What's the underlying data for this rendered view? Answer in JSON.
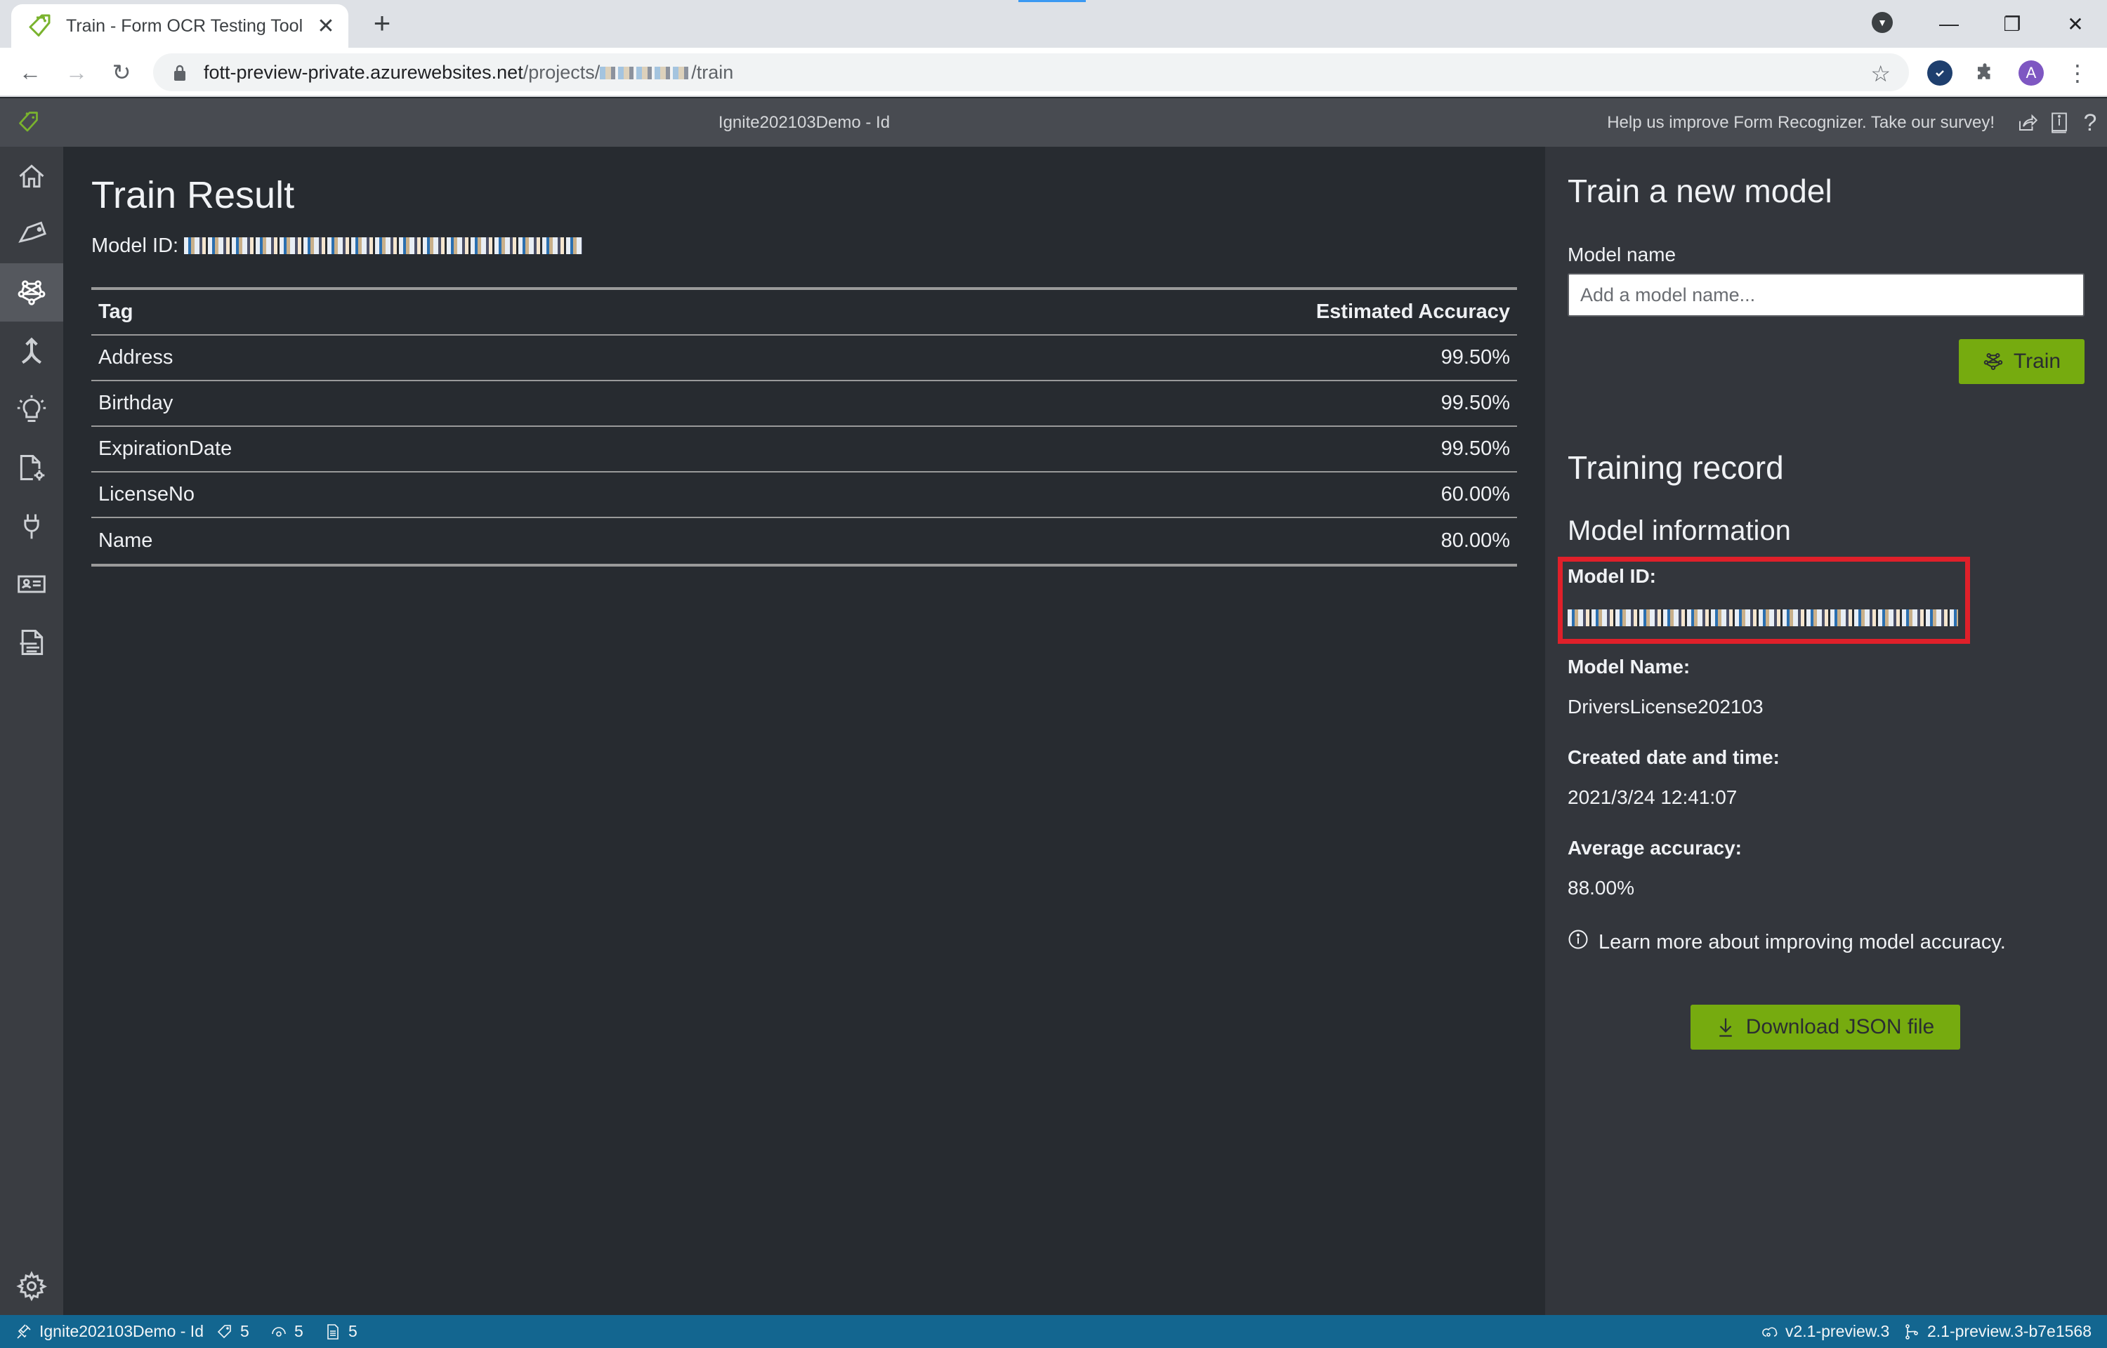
{
  "browser": {
    "tab_title": "Train - Form OCR Testing Tool",
    "close_tab_glyph": "✕",
    "new_tab_glyph": "+",
    "url_host": "fott-preview-private.azurewebsites.net",
    "url_path_prefix": "/projects/",
    "url_path_suffix": "/train",
    "profile_initial": "A",
    "window_controls": {
      "minimize": "—",
      "restore": "❐",
      "close": "✕"
    },
    "nav": {
      "back": "←",
      "forward": "→",
      "reload": "↻"
    },
    "star_glyph": "☆",
    "menu_glyph": "⋮"
  },
  "app": {
    "project_title": "Ignite202103Demo - Id",
    "survey_text": "Help us improve Form Recognizer. Take our survey!",
    "header_icons": [
      "share-icon",
      "info-book-icon",
      "help-icon"
    ],
    "accent_color": "#76ab0f"
  },
  "sidebar": {
    "items": [
      {
        "name": "home",
        "icon": "home-icon",
        "active": false
      },
      {
        "name": "tags-editor",
        "icon": "tag-icon",
        "active": false
      },
      {
        "name": "train",
        "icon": "train-network-icon",
        "active": true
      },
      {
        "name": "compose",
        "icon": "merge-icon",
        "active": false
      },
      {
        "name": "analyze",
        "icon": "lightbulb-icon",
        "active": false
      },
      {
        "name": "prebuilt",
        "icon": "document-settings-icon",
        "active": false
      },
      {
        "name": "connections",
        "icon": "plug-icon",
        "active": false
      },
      {
        "name": "layout",
        "icon": "contact-card-icon",
        "active": false
      },
      {
        "name": "read",
        "icon": "document-lines-icon",
        "active": false
      }
    ],
    "settings_icon": "gear-icon"
  },
  "main": {
    "title": "Train Result",
    "model_id_label": "Model ID:",
    "table": {
      "headers": [
        "Tag",
        "Estimated Accuracy"
      ],
      "rows": [
        {
          "tag": "Address",
          "accuracy": "99.50%"
        },
        {
          "tag": "Birthday",
          "accuracy": "99.50%"
        },
        {
          "tag": "ExpirationDate",
          "accuracy": "99.50%"
        },
        {
          "tag": "LicenseNo",
          "accuracy": "60.00%"
        },
        {
          "tag": "Name",
          "accuracy": "80.00%"
        }
      ]
    }
  },
  "right_panel": {
    "train_heading": "Train a new model",
    "model_name_label": "Model name",
    "model_name_placeholder": "Add a model name...",
    "model_name_value": "",
    "train_button": "Train",
    "record_heading": "Training record",
    "info_heading": "Model information",
    "model_id_label": "Model ID:",
    "model_name_field_label": "Model Name:",
    "model_name_field_value": "DriversLicense202103",
    "created_label": "Created date and time:",
    "created_value": "2021/3/24 12:41:07",
    "avg_accuracy_label": "Average accuracy:",
    "avg_accuracy_value": "88.00%",
    "learn_more": "Learn more about improving model accuracy.",
    "download_button": "Download JSON file"
  },
  "statusbar": {
    "project": "Ignite202103Demo - Id",
    "tag_count": "5",
    "visited_count": "5",
    "asset_count": "5",
    "api_version": "v2.1-preview.3",
    "build_version": "2.1-preview.3-b7e1568"
  }
}
